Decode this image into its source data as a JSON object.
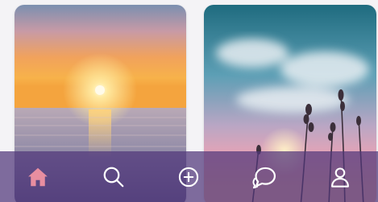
{
  "feed": {
    "cards": [
      {
        "name": "sunset-over-sea-photo"
      },
      {
        "name": "lavender-sky-photo"
      }
    ]
  },
  "bottom_nav": {
    "background": "#50367a",
    "items": [
      {
        "icon": "home-icon",
        "active": true,
        "color": "#e88ea0"
      },
      {
        "icon": "search-icon",
        "active": false,
        "color": "#ffffff"
      },
      {
        "icon": "add-icon",
        "active": false,
        "color": "#ffffff"
      },
      {
        "icon": "chat-icon",
        "active": false,
        "color": "#ffffff"
      },
      {
        "icon": "profile-icon",
        "active": false,
        "color": "#ffffff"
      }
    ]
  }
}
